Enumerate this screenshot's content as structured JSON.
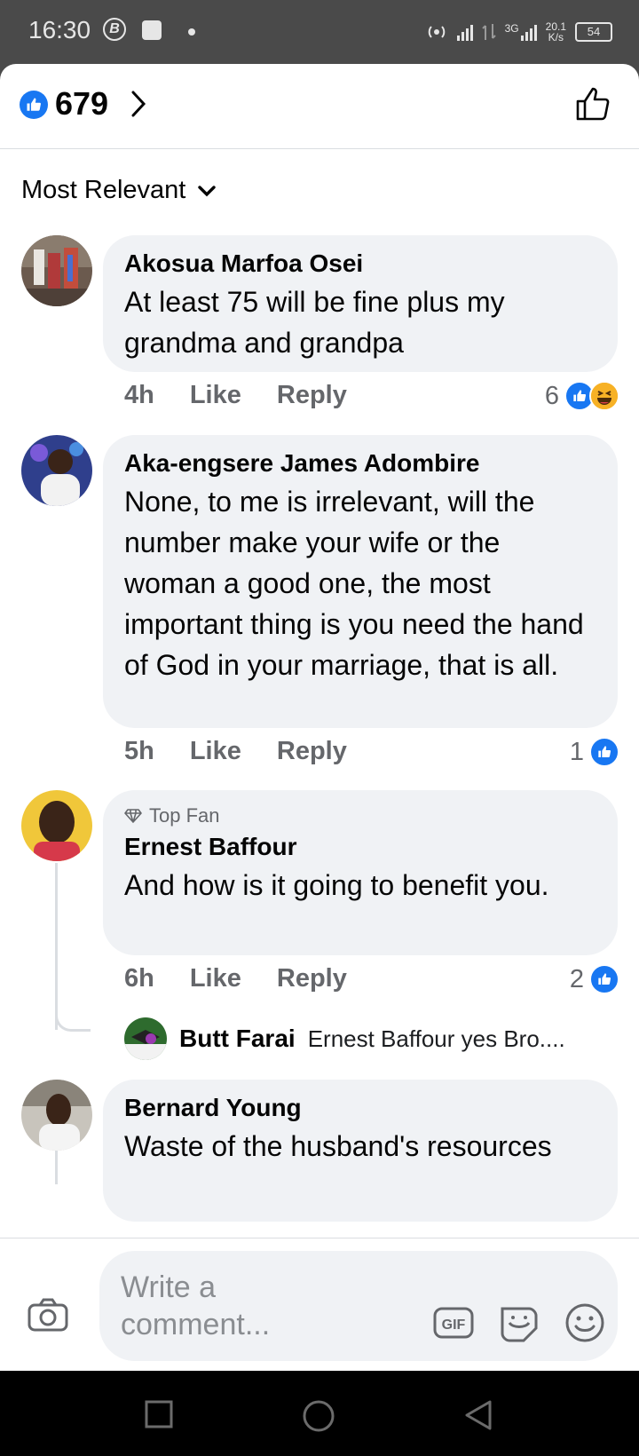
{
  "status_bar": {
    "time": "16:30",
    "icon_b": "B",
    "net_type": "3G",
    "speed_value": "20.1",
    "speed_unit": "K/s",
    "battery": "54"
  },
  "header": {
    "like_count": "679"
  },
  "sort": {
    "label": "Most Relevant"
  },
  "comments": [
    {
      "author": "Akosua Marfoa Osei",
      "text": "At least 75 will be fine plus my grandma and grandpa",
      "time": "4h",
      "like_label": "Like",
      "reply_label": "Reply",
      "reaction_count": "6",
      "reactions": [
        "like-icon",
        "haha-icon"
      ]
    },
    {
      "author": "Aka-engsere James Adombire",
      "text": "None, to me  is irrelevant, will the number make your wife or the woman a good one, the most important thing is you need the hand of God in your marriage, that is all.",
      "time": "5h",
      "like_label": "Like",
      "reply_label": "Reply",
      "reaction_count": "1",
      "reactions": [
        "like-icon"
      ]
    },
    {
      "badge": "Top Fan",
      "author": "Ernest Baffour",
      "text": "And how is it going to benefit you.",
      "time": "6h",
      "like_label": "Like",
      "reply_label": "Reply",
      "reaction_count": "2",
      "reactions": [
        "like-icon"
      ],
      "reply": {
        "author": "Butt Farai",
        "snippet": "Ernest Baffour yes Bro...."
      }
    },
    {
      "author": "Bernard Young",
      "text": "Waste of the husband's resources"
    }
  ],
  "composer": {
    "placeholder": "Write a comment..."
  },
  "colors": {
    "accent": "#1877f2",
    "bubble": "#f0f2f5",
    "secondary_text": "#65676b"
  }
}
